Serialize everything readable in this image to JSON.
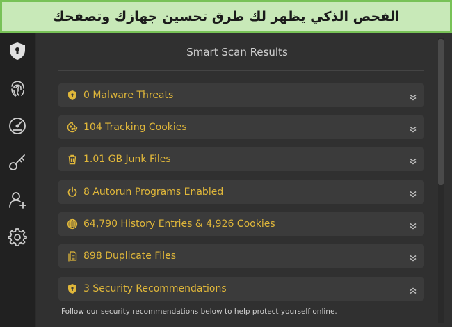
{
  "banner": {
    "text": "الفحص الذكي يظهر لك طرق تحسين جهازك وتصفحك"
  },
  "sidebar": {
    "items": [
      {
        "icon": "shield-icon"
      },
      {
        "icon": "fingerprint-icon"
      },
      {
        "icon": "speedometer-icon"
      },
      {
        "icon": "key-icon"
      },
      {
        "icon": "add-user-icon"
      },
      {
        "icon": "gear-icon"
      }
    ]
  },
  "main": {
    "title": "Smart Scan Results",
    "results": [
      {
        "label": "0 Malware Threats",
        "icon": "shield-icon",
        "expanded": false
      },
      {
        "label": "104 Tracking Cookies",
        "icon": "cookie-icon",
        "expanded": false
      },
      {
        "label": "1.01 GB Junk Files",
        "icon": "trash-icon",
        "expanded": false
      },
      {
        "label": "8 Autorun Programs Enabled",
        "icon": "power-icon",
        "expanded": false
      },
      {
        "label": "64,790 History Entries & 4,926 Cookies",
        "icon": "globe-icon",
        "expanded": false
      },
      {
        "label": "898 Duplicate Files",
        "icon": "files-icon",
        "expanded": false
      },
      {
        "label": "3 Security Recommendations",
        "icon": "shield-icon",
        "expanded": true
      }
    ],
    "note": "Follow our security recommendations below to help protect yourself online."
  },
  "colors": {
    "accent": "#e0b73a",
    "banner_bg": "#c8e9b8",
    "banner_border": "#78c257"
  }
}
